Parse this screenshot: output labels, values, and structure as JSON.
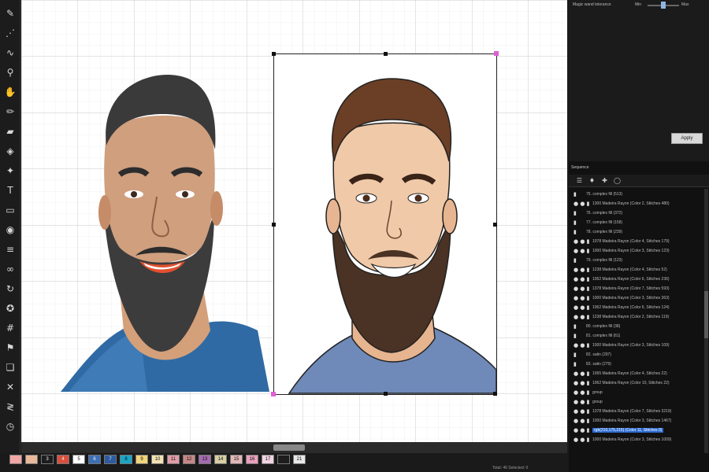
{
  "toolbar": {
    "tools": [
      {
        "icon": "pen-icon",
        "glyph": "✎"
      },
      {
        "icon": "node-icon",
        "glyph": "⋰"
      },
      {
        "icon": "curve-icon",
        "glyph": "∿"
      },
      {
        "icon": "zoom-icon",
        "glyph": "⚲"
      },
      {
        "icon": "hand-icon",
        "glyph": "✋"
      },
      {
        "icon": "brush-icon",
        "glyph": "✏"
      },
      {
        "icon": "eraser-icon",
        "glyph": "▰"
      },
      {
        "icon": "fill-icon",
        "glyph": "◈"
      },
      {
        "icon": "wand-icon",
        "glyph": "✦"
      },
      {
        "icon": "text-icon",
        "glyph": "T"
      },
      {
        "icon": "shape-icon",
        "glyph": "▭"
      },
      {
        "icon": "eye-icon",
        "glyph": "◉"
      },
      {
        "icon": "align-icon",
        "glyph": "≡"
      },
      {
        "icon": "link-icon",
        "glyph": "∞"
      },
      {
        "icon": "rotate-icon",
        "glyph": "↻"
      },
      {
        "icon": "star-icon",
        "glyph": "✪"
      },
      {
        "icon": "grid-icon",
        "glyph": "#"
      },
      {
        "icon": "flag-icon",
        "glyph": "⚑"
      },
      {
        "icon": "layers-icon",
        "glyph": "❏"
      },
      {
        "icon": "cross-icon",
        "glyph": "✕"
      },
      {
        "icon": "zigzag-icon",
        "glyph": "≷"
      },
      {
        "icon": "clock-icon",
        "glyph": "◷"
      }
    ]
  },
  "properties": {
    "title": "Magic wand tolerance",
    "min_label": "Min",
    "max_label": "Max",
    "apply_label": "Apply"
  },
  "sequence": {
    "title": "Sequence",
    "rows": [
      {
        "icons": "▮",
        "text": "75. complex fill (513)",
        "indent": 22
      },
      {
        "icons": "● ● ▮",
        "text": "1300 Madeira Rayon (Color 2, Stitches 480)",
        "indent": 30
      },
      {
        "icons": "▮",
        "text": "76. complex fill (372)",
        "indent": 22
      },
      {
        "icons": "▮",
        "text": "77. complex fill (158)",
        "indent": 22
      },
      {
        "icons": "▮",
        "text": "78. complex fill (239)",
        "indent": 22
      },
      {
        "icons": "● ● ▮",
        "text": "1078 Madeira Rayon (Color 4, Stitches 179)",
        "indent": 30
      },
      {
        "icons": "● ● ▮",
        "text": "1000 Madeira Rayon (Color 3, Stitches 123)",
        "indent": 30
      },
      {
        "icons": "▮",
        "text": "79. complex fill (123)",
        "indent": 22
      },
      {
        "icons": "● ● ▮",
        "text": "1238 Madeira Rayon (Color 4, Stitches 52)",
        "indent": 30
      },
      {
        "icons": "● ● ▮",
        "text": "1062 Madeira Rayon (Color 6, Stitches 236)",
        "indent": 30
      },
      {
        "icons": "● ● ▮",
        "text": "1378 Madeira Rayon (Color 7, Stitches 593)",
        "indent": 30
      },
      {
        "icons": "● ● ▮",
        "text": "1000 Madeira Rayon (Color 3, Stitches 363)",
        "indent": 30
      },
      {
        "icons": "● ● ▮",
        "text": "1062 Madeira Rayon (Color 6, Stitches 124)",
        "indent": 30
      },
      {
        "icons": "● ● ▮",
        "text": "1238 Madeira Rayon (Color 2, Stitches 119)",
        "indent": 30
      },
      {
        "icons": "▮",
        "text": "80. complex fill (38)",
        "indent": 22
      },
      {
        "icons": "▮",
        "text": "81. complex fill (61)",
        "indent": 22
      },
      {
        "icons": "● ● ▮",
        "text": "1000 Madeira Rayon (Color 3, Stitches 109)",
        "indent": 30
      },
      {
        "icons": "▮",
        "text": "82. satin (297)",
        "indent": 22
      },
      {
        "icons": "▮",
        "text": "83. satin (279)",
        "indent": 22
      },
      {
        "icons": "● ● ▮",
        "text": "1065 Madeira Rayon (Color 4, Stitches 22)",
        "indent": 30
      },
      {
        "icons": "● ● ▮",
        "text": "1062 Madeira Rayon (Color 10, Stitches 22)",
        "indent": 30
      },
      {
        "icons": "● ● ▮",
        "text": "group",
        "indent": 30
      },
      {
        "icons": "● ● ▮",
        "text": "group",
        "indent": 30
      },
      {
        "icons": "● ● ▮",
        "text": "1378 Madeira Rayon (Color 7, Stitches 3219)",
        "indent": 30
      },
      {
        "icons": "● ● ▮",
        "text": "1000 Madeira Rayon (Color 3, Stitches 1467)",
        "indent": 30
      },
      {
        "icons": "● ● ▮",
        "text": "rgb(210,175,215) (Color 11, Stitches 0)",
        "indent": 30,
        "selected": true
      },
      {
        "icons": "● ● ▮",
        "text": "1000 Madeira Rayon (Color 3, Stitches 1009)",
        "indent": 30
      }
    ]
  },
  "palette": {
    "swatches": [
      {
        "label": "",
        "color": "#f1a5a5"
      },
      {
        "label": "",
        "color": "#e9b89b"
      },
      {
        "label": "3",
        "color": "#1d1d1d"
      },
      {
        "label": "4",
        "color": "#d94f3c"
      },
      {
        "label": "5",
        "color": "#ffffff"
      },
      {
        "label": "6",
        "color": "#3c6fb5"
      },
      {
        "label": "7",
        "color": "#2e5aa0"
      },
      {
        "label": "8",
        "color": "#19a6c7"
      },
      {
        "label": "9",
        "color": "#f0d57a"
      },
      {
        "label": "10",
        "color": "#f3e3b4"
      },
      {
        "label": "11",
        "color": "#e19ca8"
      },
      {
        "label": "12",
        "color": "#c98686"
      },
      {
        "label": "13",
        "color": "#a56bb0"
      },
      {
        "label": "14",
        "color": "#d7cfa3"
      },
      {
        "label": "15",
        "color": "#e3b7b7"
      },
      {
        "label": "16",
        "color": "#eaa0bc"
      },
      {
        "label": "17",
        "color": "#f1d4e2"
      },
      {
        "label": "",
        "color": "#1d1d1d"
      },
      {
        "label": "21",
        "color": "#e8e8e8"
      }
    ],
    "status": "Total: 46  Selected: 0"
  },
  "images": {
    "embroidery_label": "embroidery portrait",
    "cartoon_label": "cartoon portrait"
  },
  "colors": {
    "accent": "#2d6bd1",
    "handle": "#e061d6"
  }
}
